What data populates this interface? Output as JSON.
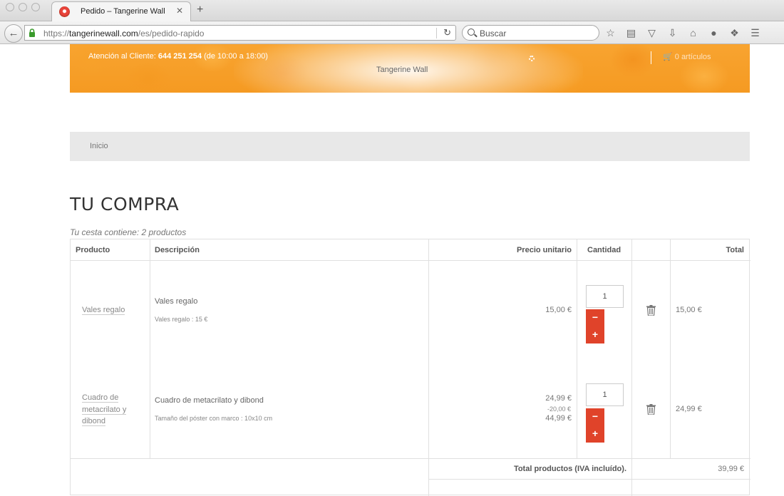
{
  "browser": {
    "tab_title": "Pedido – Tangerine Wall",
    "tab_close": "✕",
    "new_tab": "+",
    "url_prefix": "https://",
    "url_host": "tangerinewall.com",
    "url_path": "/es/pedido-rapido",
    "search_placeholder": "Buscar",
    "toolbar_icons": [
      "star-icon",
      "reading-list-icon",
      "pocket-icon",
      "download-icon",
      "home-icon",
      "chat-icon",
      "extension-icon",
      "menu-icon"
    ]
  },
  "header": {
    "contact_label": "Atención al Cliente: ",
    "contact_phone": "644 251 254",
    "contact_hours": " (de 10:00 a 18:00)",
    "brand": "Tangerine Wall",
    "cart_text": "0 artículos"
  },
  "breadcrumb": {
    "home": "Inicio"
  },
  "page": {
    "title": "TU COMPRA",
    "summary": "Tu cesta contiene: 2 productos"
  },
  "table": {
    "headers": {
      "product": "Producto",
      "description": "Descripción",
      "unit_price": "Precio unitario",
      "quantity": "Cantidad",
      "total": "Total"
    },
    "rows": [
      {
        "product_link": "Vales regalo",
        "desc_title": "Vales regalo",
        "desc_sub": "Vales regalo : 15 €",
        "price": "15,00 €",
        "quantity": "1",
        "total": "15,00 €"
      },
      {
        "product_link_line1": "Cuadro de",
        "product_link_line2": "metacrilato y",
        "product_link_line3": "dibond",
        "desc_title": "Cuadro de metacrilato y dibond",
        "desc_sub": "Tamaño del póster con marco : 10x10 cm",
        "price": "24,99 €",
        "discount": "-20,00 €",
        "old_price": "44,99 €",
        "quantity": "1",
        "total": "24,99 €"
      }
    ],
    "minus": "−",
    "plus": "+",
    "total_products_label": "Total productos (IVA incluído).",
    "total_products_value": "39,99 €"
  }
}
